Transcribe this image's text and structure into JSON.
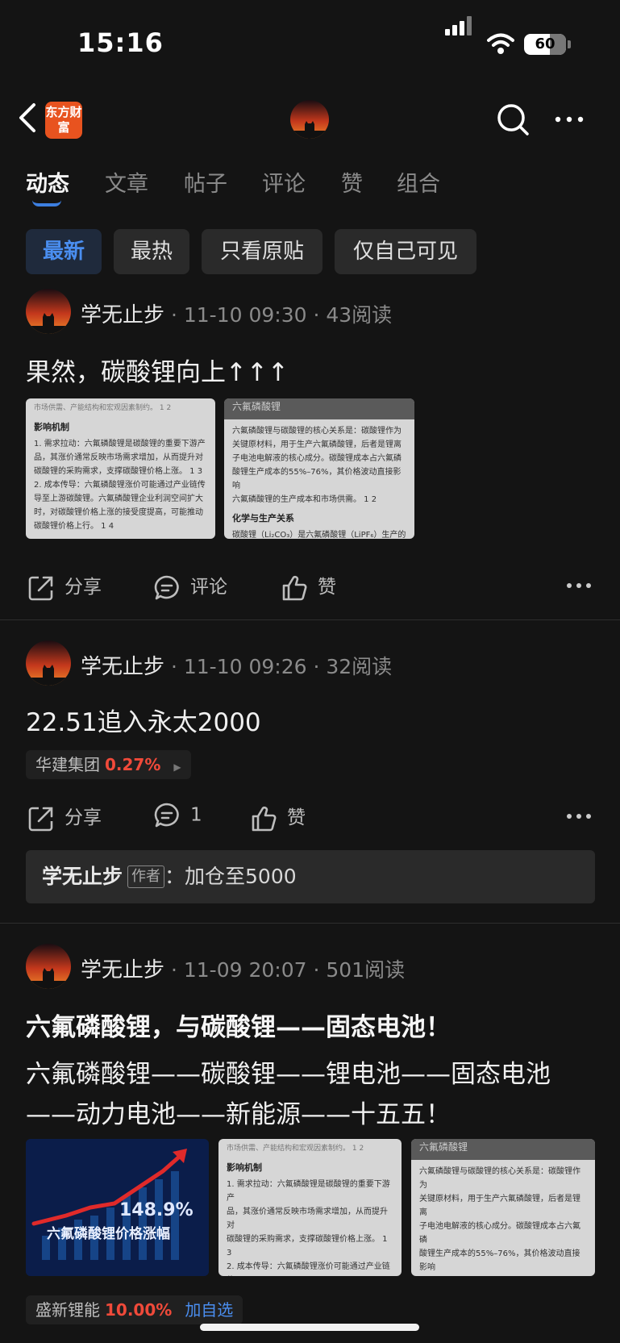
{
  "status_bar": {
    "time": "15:16",
    "battery": "60"
  },
  "nav": {
    "logo_text": "东方财富"
  },
  "tabs": [
    {
      "label": "动态",
      "active": true
    },
    {
      "label": "文章"
    },
    {
      "label": "帖子"
    },
    {
      "label": "评论"
    },
    {
      "label": "赞"
    },
    {
      "label": "组合"
    }
  ],
  "filters": [
    {
      "label": "最新",
      "active": true
    },
    {
      "label": "最热"
    },
    {
      "label": "只看原贴"
    },
    {
      "label": "仅自己可见"
    }
  ],
  "posts": [
    {
      "author": "学无止步",
      "time": "11-10 09:30",
      "reads": "43阅读",
      "text": "果然，碳酸锂向上↑↑↑",
      "images": [
        {
          "top": "市场供需、产能结构和宏观因素制约。 1 2",
          "heading": "影响机制",
          "lines": [
            "1. 需求拉动：六氟磷酸锂是碳酸锂的重要下游产",
            "品，其涨价通常反映市场需求增加，从而提升对",
            "碳酸锂的采购需求，支撑碳酸锂价格上涨。 1 3",
            "2. 成本传导：六氟磷酸锂涨价可能通过产业链传",
            "导至上游碳酸锂。六氟磷酸锂企业利润空间扩大",
            "时，对碳酸锂价格上涨的接受度提高，可能推动",
            "碳酸锂价格上行。 1 4"
          ]
        },
        {
          "top": "六氟磷酸锂",
          "lines": [
            "六氟磷酸锂与碳酸锂的核心关系是：碳酸锂作为",
            "关键原材料，用于生产六氟磷酸锂，后者是锂离",
            "子电池电解液的核心成分。碳酸锂成本占六氟磷",
            "酸锂生产成本的55%–76%，其价格波动直接影响",
            "六氟磷酸锂的生产成本和市场供需。 1 2"
          ],
          "heading": "化学与生产关系",
          "bottom": "碳酸锂（Li₂CO₃）是六氟磷酸锂（LiPF₆）生产的"
        }
      ],
      "actions": {
        "share": "分享",
        "comment": "评论",
        "like": "赞"
      }
    },
    {
      "author": "学无止步",
      "time": "11-10 09:26",
      "reads": "32阅读",
      "text": "22.51追入永太2000",
      "stock": {
        "name": "华建集团",
        "change": "0.27%"
      },
      "actions": {
        "share": "分享",
        "comment": "1",
        "like": "赞"
      },
      "reply": {
        "name": "学无止步",
        "badge": "作者",
        "text": "加仓至5000"
      }
    },
    {
      "author": "学无止步",
      "time": "11-09 20:07",
      "reads": "501阅读",
      "title": "六氟磷酸锂，与碳酸锂——固态电池！",
      "text_line1": "六氟磷酸锂——碳酸锂——锂电池——固态电池",
      "text_line2": "——动力电池——新能源——十五五！",
      "chart_image": {
        "value": "148.9%",
        "caption": "六氟磷酸锂价格涨幅"
      },
      "stock": {
        "name": "盛新锂能",
        "change": "10.00%",
        "add": "加自选"
      }
    }
  ],
  "colors": {
    "accent_blue": "#4a8ef0",
    "up_red": "#f04a3a",
    "brand_orange": "#e8531f"
  }
}
